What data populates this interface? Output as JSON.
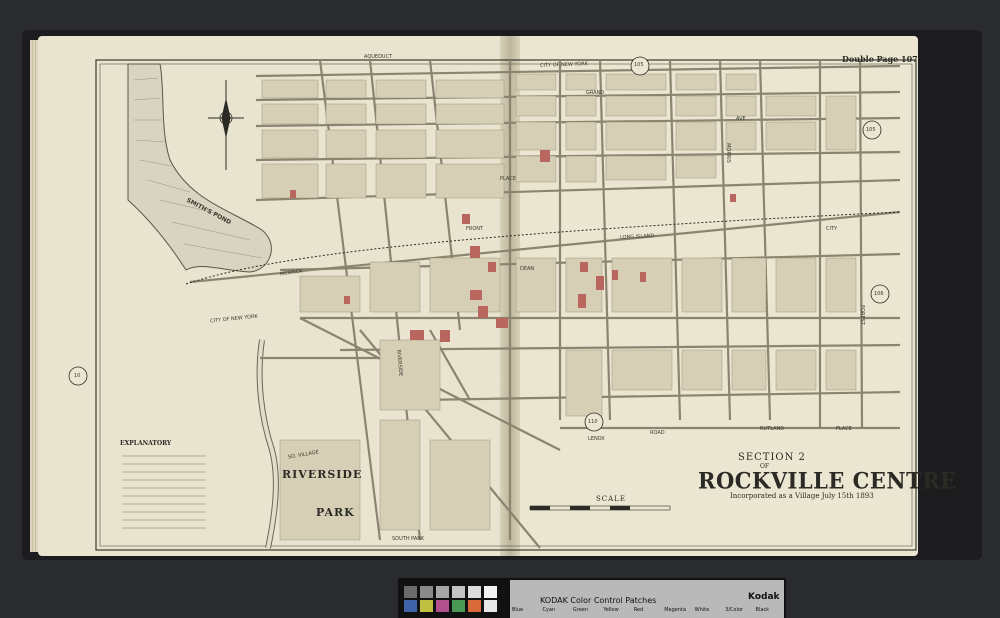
{
  "map": {
    "page_label": "Double Page 107",
    "section": "SECTION 2",
    "of": "OF",
    "title": "ROCKVILLE CENTRE",
    "subtitle": "Incorporated as a Village July 15th 1893",
    "scale_label": "SCALE",
    "explanatory_label": "EXPLANATORY",
    "pond_label": "SMITH'S POND",
    "park_word_1": "RIVERSIDE",
    "park_word_2": "PARK",
    "plate_numbers": [
      "105",
      "105",
      "106",
      "110",
      "10"
    ],
    "streets": [
      "AQUEDUCT",
      "CITY OF NEW YORK",
      "GRAND",
      "MORRIS",
      "AVE",
      "FRONT",
      "DEAN",
      "PLACE",
      "LENOX",
      "RUTLAND",
      "PLACE",
      "RIVERSIDE",
      "SO. VILLAGE",
      "SOUTH PARK",
      "CITY OF NEW YORK",
      "CITY",
      "MERRICK",
      "FOREST",
      "ROAD",
      "LONG ISLAND"
    ]
  },
  "color_patches": {
    "label": "KODAK Color Control Patches",
    "brand": "Kodak",
    "swatches": [
      "Blue",
      "Cyan",
      "Green",
      "Yellow",
      "Red",
      "Magenta",
      "White",
      "3/Color",
      "Black"
    ],
    "colors": [
      "#2d4e9a",
      "#4aa5d8",
      "#3d8f4a",
      "#e7d44a",
      "#c23a33",
      "#b2457f",
      "#f0f0f0",
      "#5a5a5a",
      "#111111"
    ]
  }
}
